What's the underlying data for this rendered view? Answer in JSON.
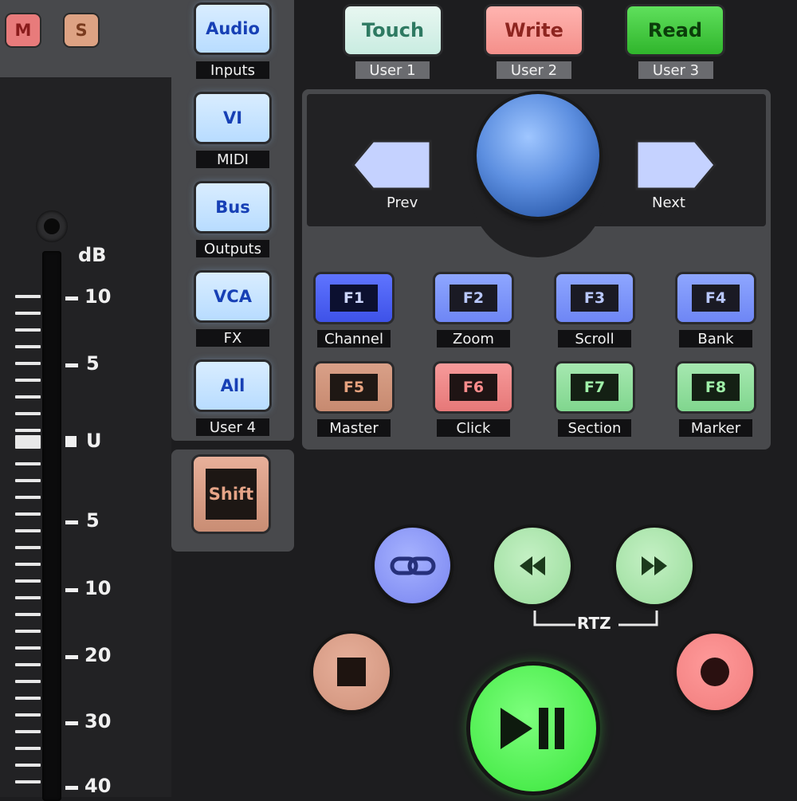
{
  "channel": {
    "mute_label": "M",
    "solo_label": "S"
  },
  "view_buttons": [
    {
      "label": "Audio",
      "tag": "Inputs"
    },
    {
      "label": "VI",
      "tag": "MIDI"
    },
    {
      "label": "Bus",
      "tag": "Outputs"
    },
    {
      "label": "VCA",
      "tag": "FX"
    },
    {
      "label": "All",
      "tag": "User 4"
    }
  ],
  "shift_label": "Shift",
  "automation": [
    {
      "label": "Touch",
      "tag": "User 1"
    },
    {
      "label": "Write",
      "tag": "User 2"
    },
    {
      "label": "Read",
      "tag": "User 3"
    }
  ],
  "nav": {
    "prev_label": "Prev",
    "next_label": "Next"
  },
  "function_keys": [
    {
      "key": "F1",
      "tag": "Channel"
    },
    {
      "key": "F2",
      "tag": "Zoom"
    },
    {
      "key": "F3",
      "tag": "Scroll"
    },
    {
      "key": "F4",
      "tag": "Bank"
    },
    {
      "key": "F5",
      "tag": "Master"
    },
    {
      "key": "F6",
      "tag": "Click"
    },
    {
      "key": "F7",
      "tag": "Section"
    },
    {
      "key": "F8",
      "tag": "Marker"
    }
  ],
  "transport": {
    "rtz_label": "RTZ"
  },
  "fader_scale": {
    "unit": "dB",
    "labels": [
      "10",
      "5",
      "U",
      "5",
      "10",
      "20",
      "30",
      "40"
    ]
  },
  "colors": {
    "touch": "#c9ece1",
    "write": "#f48f8a",
    "read": "#30b52c",
    "view_button": "#b8dcff",
    "play": "#38e53a",
    "record": "#f07c7c"
  }
}
